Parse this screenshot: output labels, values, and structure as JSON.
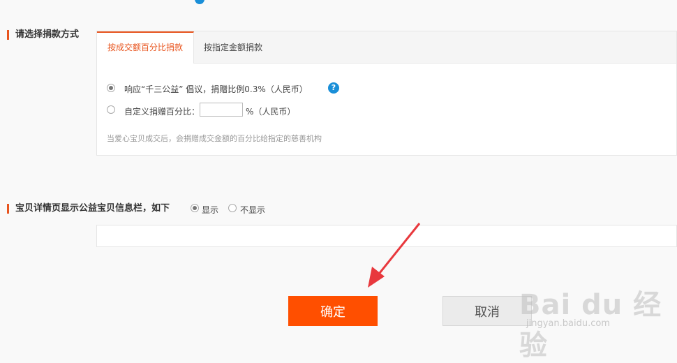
{
  "donation_section": {
    "title": "请选择捐款方式",
    "tabs": [
      {
        "label": "按成交额百分比捐款",
        "active": true
      },
      {
        "label": "按指定金额捐款",
        "active": false
      }
    ],
    "option_1": {
      "label": "响应“千三公益” 倡议，捐赠比例0.3%（人民币）",
      "selected": true
    },
    "option_2": {
      "label_before": "自定义捐赠百分比：",
      "input_value": "",
      "label_after": "%（人民币）",
      "selected": false
    },
    "hint": "当爱心宝贝成交后，会捐赠成交金额的百分比给指定的慈善机构",
    "help_icon_glyph": "?"
  },
  "display_section": {
    "title": "宝贝详情页显示公益宝贝信息栏，如下",
    "options": [
      {
        "label": "显示",
        "selected": true
      },
      {
        "label": "不显示",
        "selected": false
      }
    ]
  },
  "actions": {
    "confirm_label": "确定",
    "cancel_label": "取消"
  },
  "watermark": {
    "brand": "Bai du 经验",
    "url": "jingyan.baidu.com"
  },
  "colors": {
    "accent": "#e8541e",
    "confirm_button": "#ff4f00",
    "arrow": "#e8383d",
    "help_icon": "#1a8fd8"
  }
}
